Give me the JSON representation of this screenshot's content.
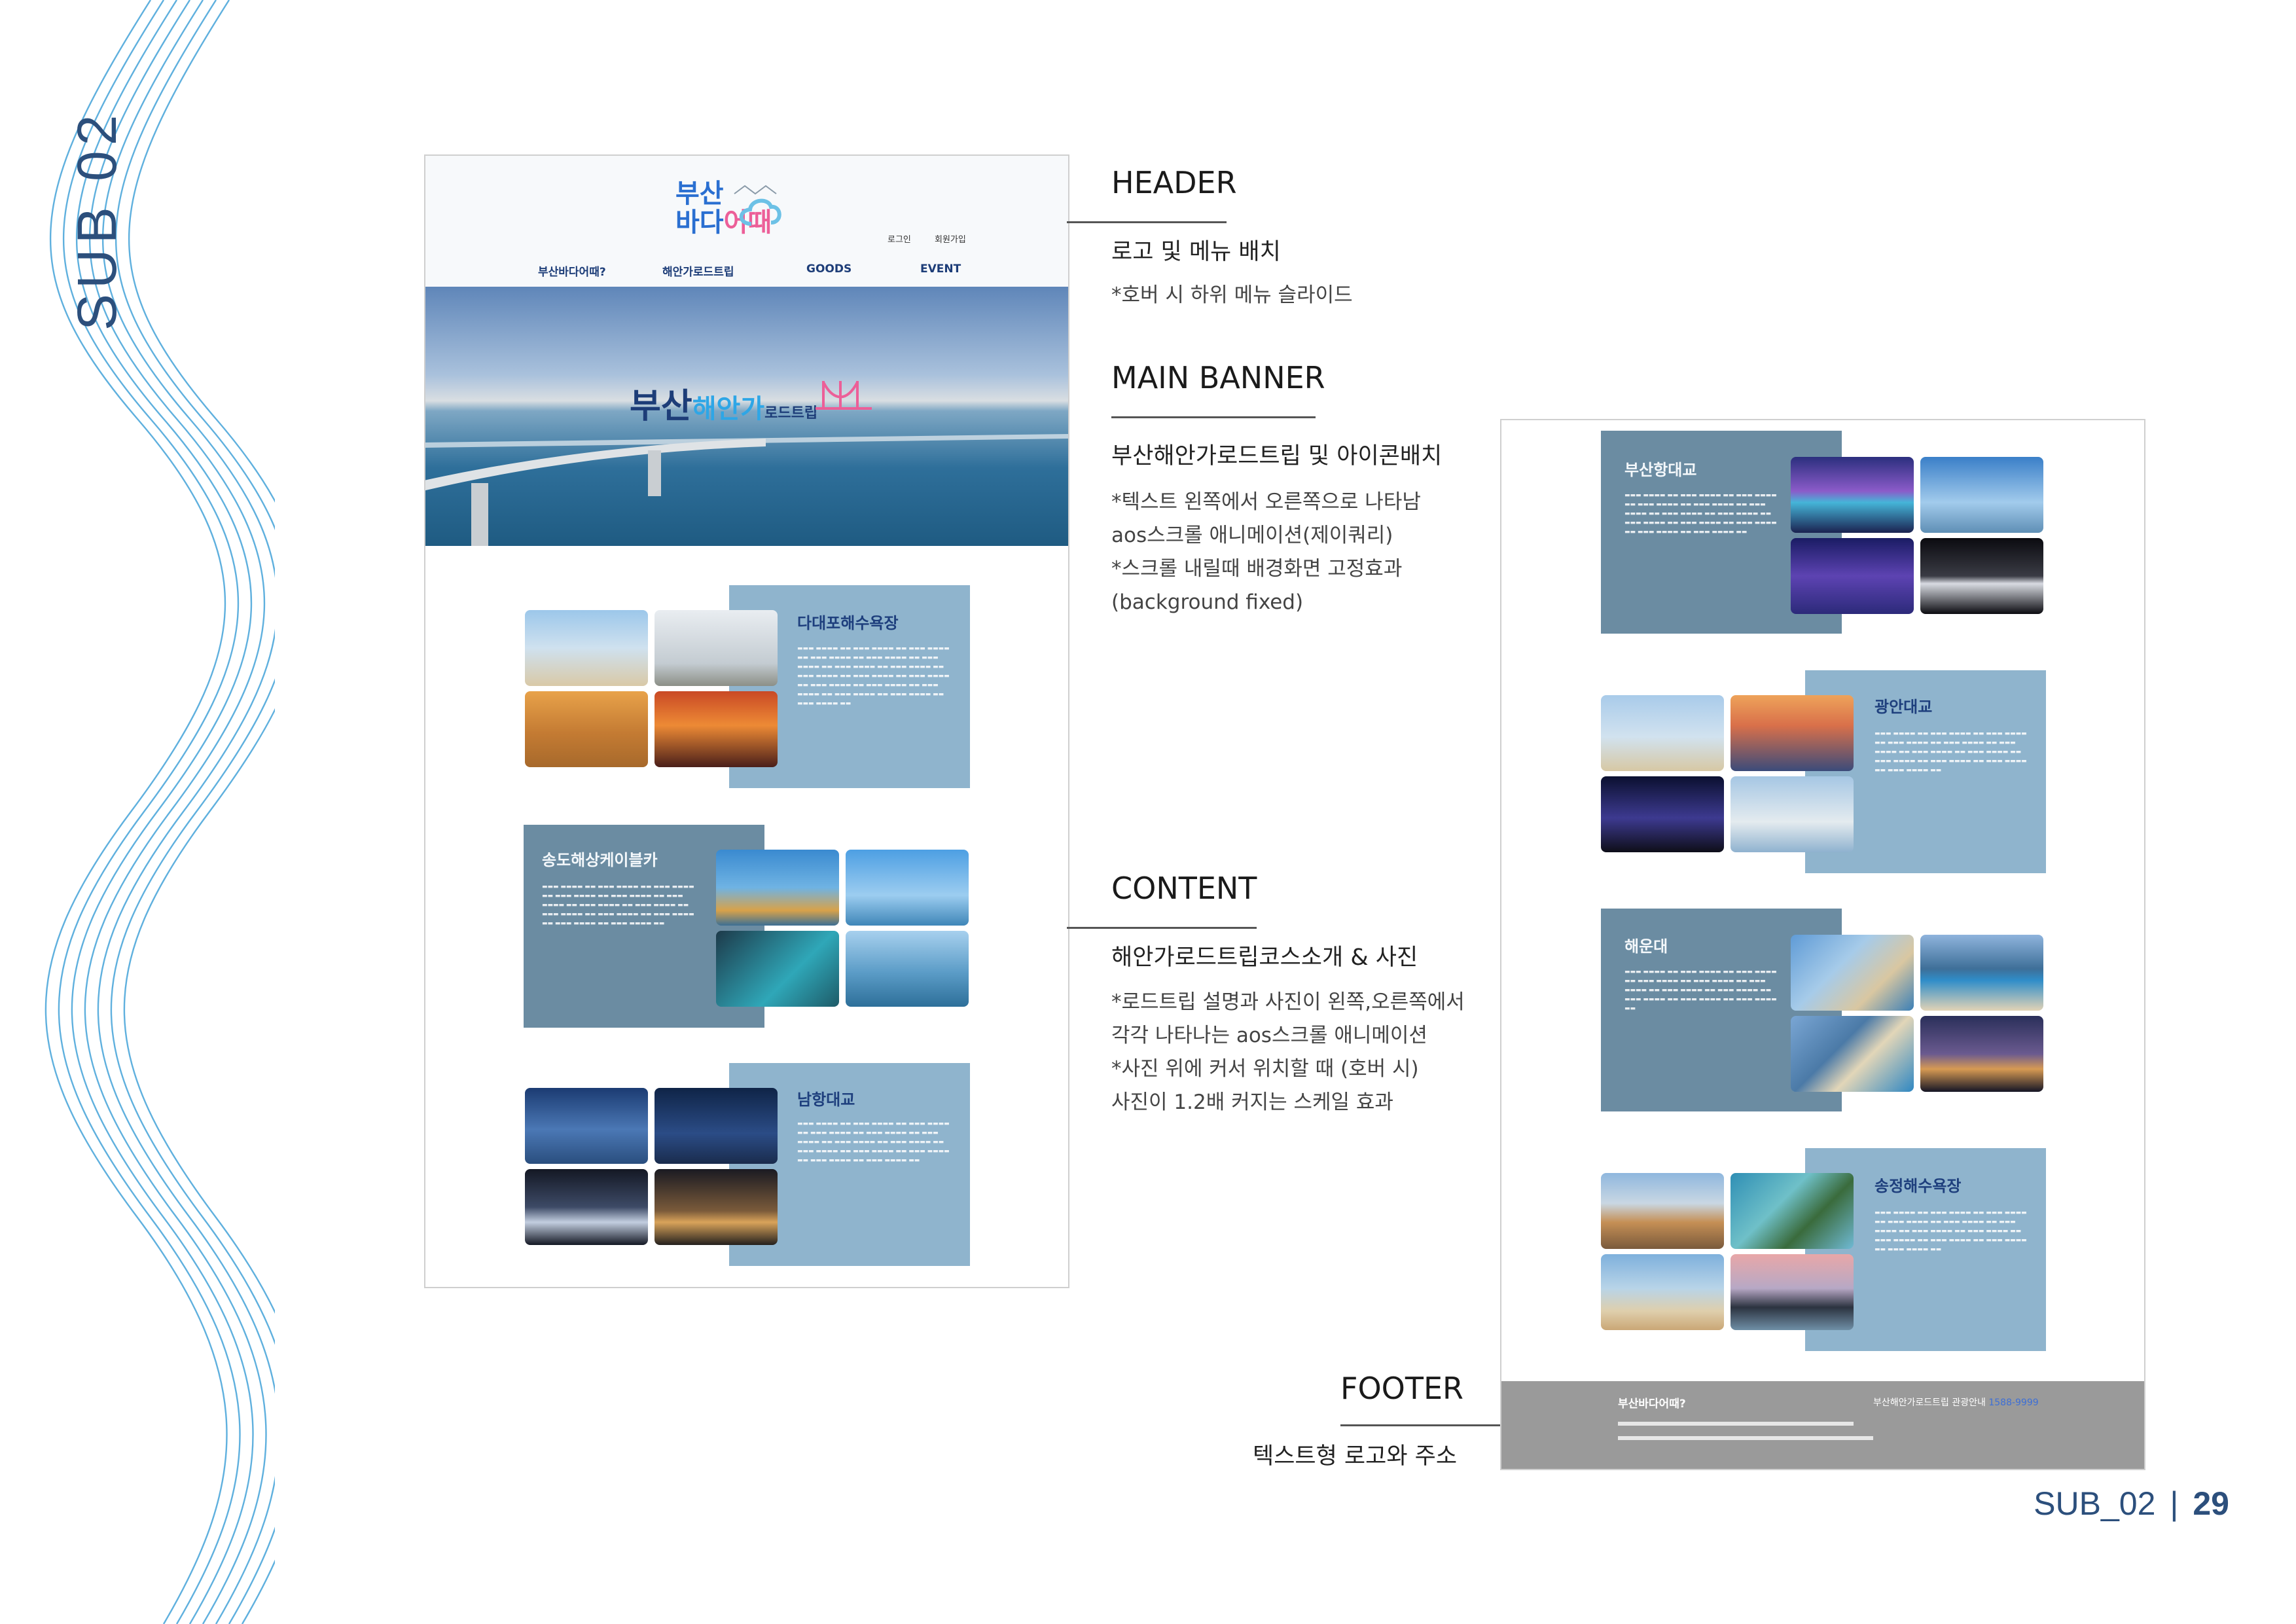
{
  "section_vertical_label": "SUB 02",
  "mockup_left": {
    "logo_line1": "부산",
    "logo_line2_a": "바다",
    "logo_line2_b": "어때",
    "top_links": [
      "로그인",
      "회원가입"
    ],
    "nav": [
      "부산바다어때?",
      "해안가로드트립",
      "GOODS",
      "EVENT"
    ],
    "banner_text_a": "부산",
    "banner_text_b": "해안가",
    "banner_text_c": "로드트립",
    "cards": [
      {
        "title": "다대포해수욕장"
      },
      {
        "title": "송도해상케이블카"
      },
      {
        "title": "남항대교"
      }
    ]
  },
  "mockup_right": {
    "cards": [
      {
        "title": "부산항대교"
      },
      {
        "title": "광안대교"
      },
      {
        "title": "해운대"
      },
      {
        "title": "송정해수욕장"
      }
    ],
    "footer_logo": "부산바다어때?",
    "footer_contact_label": "부산해안가로드트립 관광안내",
    "footer_phone": "1588-9999"
  },
  "annotations": {
    "header": {
      "title": "HEADER",
      "sub": "로고 및 메뉴 배치",
      "notes": [
        "*호버 시 하위 메뉴 슬라이드"
      ]
    },
    "main_banner": {
      "title": "MAIN BANNER",
      "sub": "부산해안가로드트립 및 아이콘배치",
      "notes": [
        "*텍스트 왼쪽에서 오른쪽으로 나타남",
        "aos스크롤 애니메이션(제이쿼리)",
        "*스크롤 내릴때 배경화면 고정효과",
        "(background fixed)"
      ]
    },
    "content": {
      "title": "CONTENT",
      "sub": "해안가로드트립코스소개 &  사진",
      "notes": [
        "*로드트립 설명과 사진이 왼쪽,오른쪽에서",
        "각각 나타나는 aos스크롤 애니메이션",
        "*사진 위에 커서 위치할 때 (호버 시)",
        "사진이 1.2배 커지는 스케일 효과"
      ]
    },
    "footer": {
      "title": "FOOTER",
      "sub": "텍스트형 로고와 주소"
    }
  },
  "page_label": "SUB_02",
  "page_number": "29",
  "colors": {
    "accent_navy": "#2c4f7c",
    "card_light": "#8fb4cd",
    "card_dark": "#6b8ca2",
    "wave": "#5fb0de",
    "footer_gray": "#9a9a9a"
  }
}
